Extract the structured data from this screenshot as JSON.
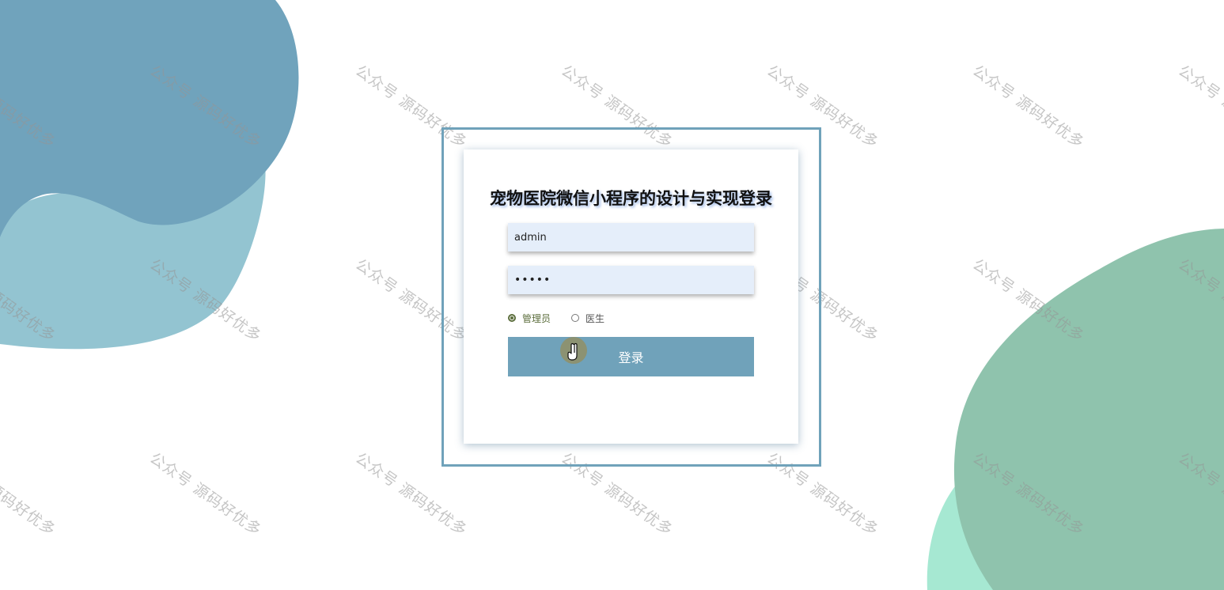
{
  "login": {
    "title": "宠物医院微信小程序的设计与实现登录",
    "username_value": "admin",
    "password_value": "•••••",
    "roles": [
      "管理员",
      "医生"
    ],
    "selected_role": "管理员",
    "submit_label": "登录"
  },
  "watermark": {
    "text": "公众号 源码好优多"
  },
  "colors": {
    "accent": "#70a2ba",
    "blob_blue_dark": "#70a3bc",
    "blob_blue_light": "#93c4d1",
    "blob_green": "#8fc3ad",
    "blob_mint": "#a6e8d2",
    "field_bg": "#e5eefa"
  },
  "icons": {
    "cursor": "hand-pointer-icon"
  }
}
